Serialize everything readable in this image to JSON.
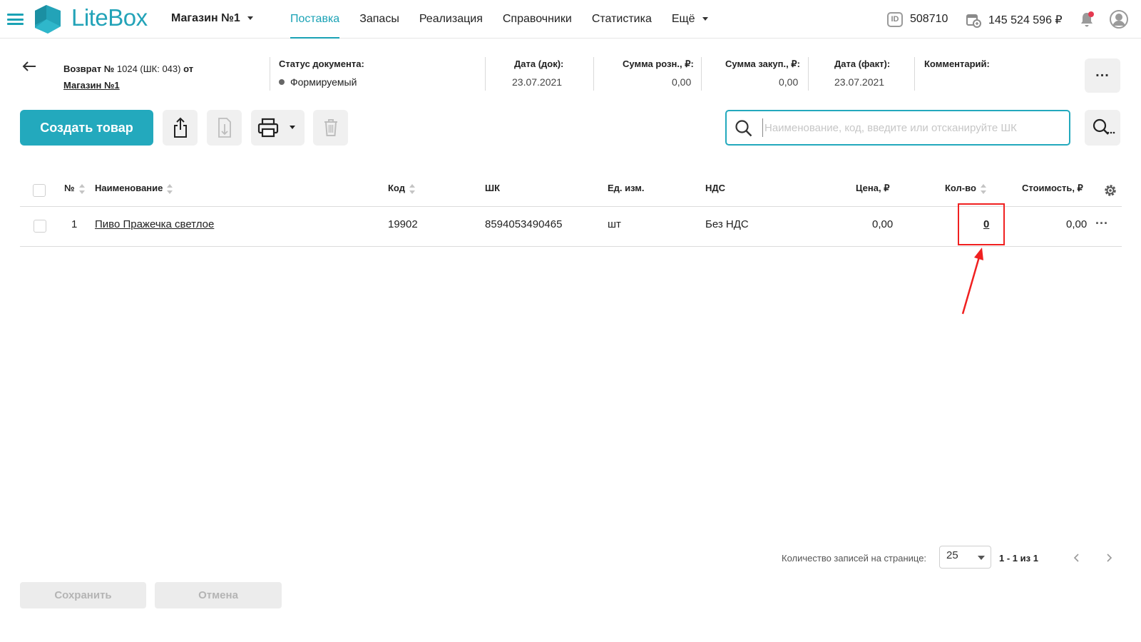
{
  "app": {
    "brand": "LiteBox",
    "accent": "#23a9bd",
    "store": "Магазин №1"
  },
  "nav": {
    "items": [
      "Поставка",
      "Запасы",
      "Реализация",
      "Справочники",
      "Статистика",
      "Ещё"
    ]
  },
  "account": {
    "id": "508710",
    "balance": "145 524 596 ₽"
  },
  "document": {
    "title_prefix": "Возврат №",
    "title_number": " 1024 (ШК: 043)",
    "title_suffix": " от",
    "store_link": "Магазин №1",
    "status_label": "Статус документа:",
    "status_value": "Формируемый",
    "doc_date_label": "Дата (док):",
    "doc_date": "23.07.2021",
    "retail_sum_label": "Сумма розн., ₽:",
    "retail_sum": "0,00",
    "purchase_sum_label": "Сумма закуп., ₽:",
    "purchase_sum": "0,00",
    "fact_date_label": "Дата (факт):",
    "fact_date": "23.07.2021",
    "comment_label": "Комментарий:",
    "more": "..."
  },
  "toolbar": {
    "create_label": "Создать товар",
    "search_placeholder": "Наименование, код, введите или отсканируйте ШК"
  },
  "table": {
    "headers": {
      "num": "№",
      "name": "Наименование",
      "code": "Код",
      "barcode": "ШК",
      "unit": "Ед. изм.",
      "vat": "НДС",
      "price": "Цена, ₽",
      "qty": "Кол-во",
      "cost": "Стоимость, ₽"
    },
    "rows": [
      {
        "num": "1",
        "name": "Пиво Пражечка светлое",
        "code": "19902",
        "barcode": "8594053490465",
        "unit": "шт",
        "vat": "Без НДС",
        "price": "0,00",
        "qty": "0",
        "cost": "0,00",
        "more": "..."
      }
    ]
  },
  "pagination": {
    "per_page_label": "Количество записей на странице:",
    "per_page": "25",
    "range": "1 - 1 из 1"
  },
  "footer": {
    "save_label": "Сохранить",
    "cancel_label": "Отмена"
  },
  "annotation_color": "#f02020"
}
